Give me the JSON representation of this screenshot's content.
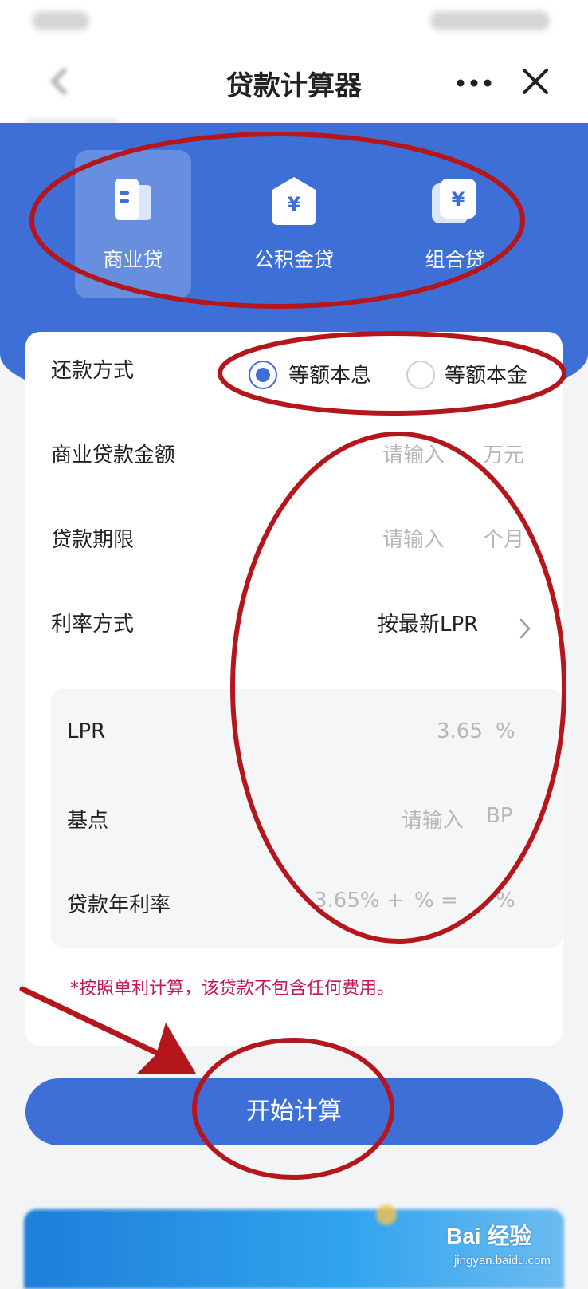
{
  "header": {
    "title": "贷款计算器"
  },
  "loan_tabs": [
    {
      "label": "商业贷",
      "icon": "building-icon",
      "selected": true
    },
    {
      "label": "公积金贷",
      "icon": "house-yuan-icon",
      "selected": false
    },
    {
      "label": "组合贷",
      "icon": "stacked-yuan-icon",
      "selected": false
    }
  ],
  "form": {
    "repayment": {
      "label": "还款方式",
      "options": [
        {
          "label": "等额本息",
          "selected": true
        },
        {
          "label": "等额本金",
          "selected": false
        }
      ]
    },
    "amount": {
      "label": "商业贷款金额",
      "placeholder": "请输入",
      "unit": "万元"
    },
    "term": {
      "label": "贷款期限",
      "placeholder": "请输入",
      "unit": "个月"
    },
    "rate_mode": {
      "label": "利率方式",
      "value": "按最新LPR"
    },
    "lpr": {
      "label": "LPR",
      "value": "3.65",
      "unit": "%"
    },
    "basis_points": {
      "label": "基点",
      "placeholder": "请输入",
      "unit": "BP"
    },
    "annual_rate": {
      "label": "贷款年利率",
      "lpr_part": "3.65% +",
      "bp_part": "% =",
      "unit": "%"
    },
    "note": "*按照单利计算，该贷款不包含任何费用。"
  },
  "calculate_button": "开始计算",
  "colors": {
    "brand_blue": "#3e6fd6",
    "note_pink": "#c2185b",
    "annotation_red": "#b5161b"
  },
  "watermark": {
    "main": "Bai 经验",
    "sub": "jingyan.baidu.com"
  }
}
